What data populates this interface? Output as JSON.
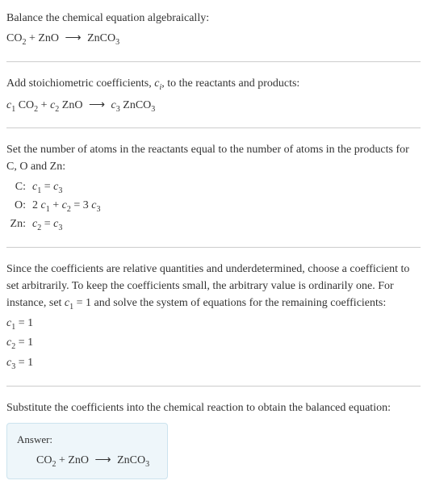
{
  "intro": {
    "instruction": "Balance the chemical equation algebraically:",
    "equation_html": "CO<span class='subnum'>2</span> + ZnO <span class='arrow'>⟶</span> ZnCO<span class='subnum'>3</span>"
  },
  "step1": {
    "text_html": "Add stoichiometric coefficients, <span class='ci'>c<span class='subnum'>i</span></span>, to the reactants and products:",
    "equation_html": "<span class='ci'>c</span><span class='subnum'>1</span> CO<span class='subnum'>2</span> + <span class='ci'>c</span><span class='subnum'>2</span> ZnO <span class='arrow'>⟶</span> <span class='ci'>c</span><span class='subnum'>3</span> ZnCO<span class='subnum'>3</span>"
  },
  "step2": {
    "text": "Set the number of atoms in the reactants equal to the number of atoms in the products for C, O and Zn:",
    "atoms": [
      {
        "label": "C:",
        "eq_html": "<span class='ci'>c</span><span class='subnum'>1</span> = <span class='ci'>c</span><span class='subnum'>3</span>"
      },
      {
        "label": "O:",
        "eq_html": "2 <span class='ci'>c</span><span class='subnum'>1</span> + <span class='ci'>c</span><span class='subnum'>2</span> = 3 <span class='ci'>c</span><span class='subnum'>3</span>"
      },
      {
        "label": "Zn:",
        "eq_html": "<span class='ci'>c</span><span class='subnum'>2</span> = <span class='ci'>c</span><span class='subnum'>3</span>"
      }
    ]
  },
  "step3": {
    "text_html": "Since the coefficients are relative quantities and underdetermined, choose a coefficient to set arbitrarily. To keep the coefficients small, the arbitrary value is ordinarily one. For instance, set <span class='ci'>c</span><span class='subnum'>1</span> = 1 and solve the system of equations for the remaining coefficients:",
    "coeffs": [
      "<span class='ci'>c</span><span class='subnum'>1</span> = 1",
      "<span class='ci'>c</span><span class='subnum'>2</span> = 1",
      "<span class='ci'>c</span><span class='subnum'>3</span> = 1"
    ]
  },
  "step4": {
    "text": "Substitute the coefficients into the chemical reaction to obtain the balanced equation:"
  },
  "answer": {
    "label": "Answer:",
    "equation_html": "CO<span class='subnum'>2</span> + ZnO <span class='arrow'>⟶</span> ZnCO<span class='subnum'>3</span>"
  }
}
